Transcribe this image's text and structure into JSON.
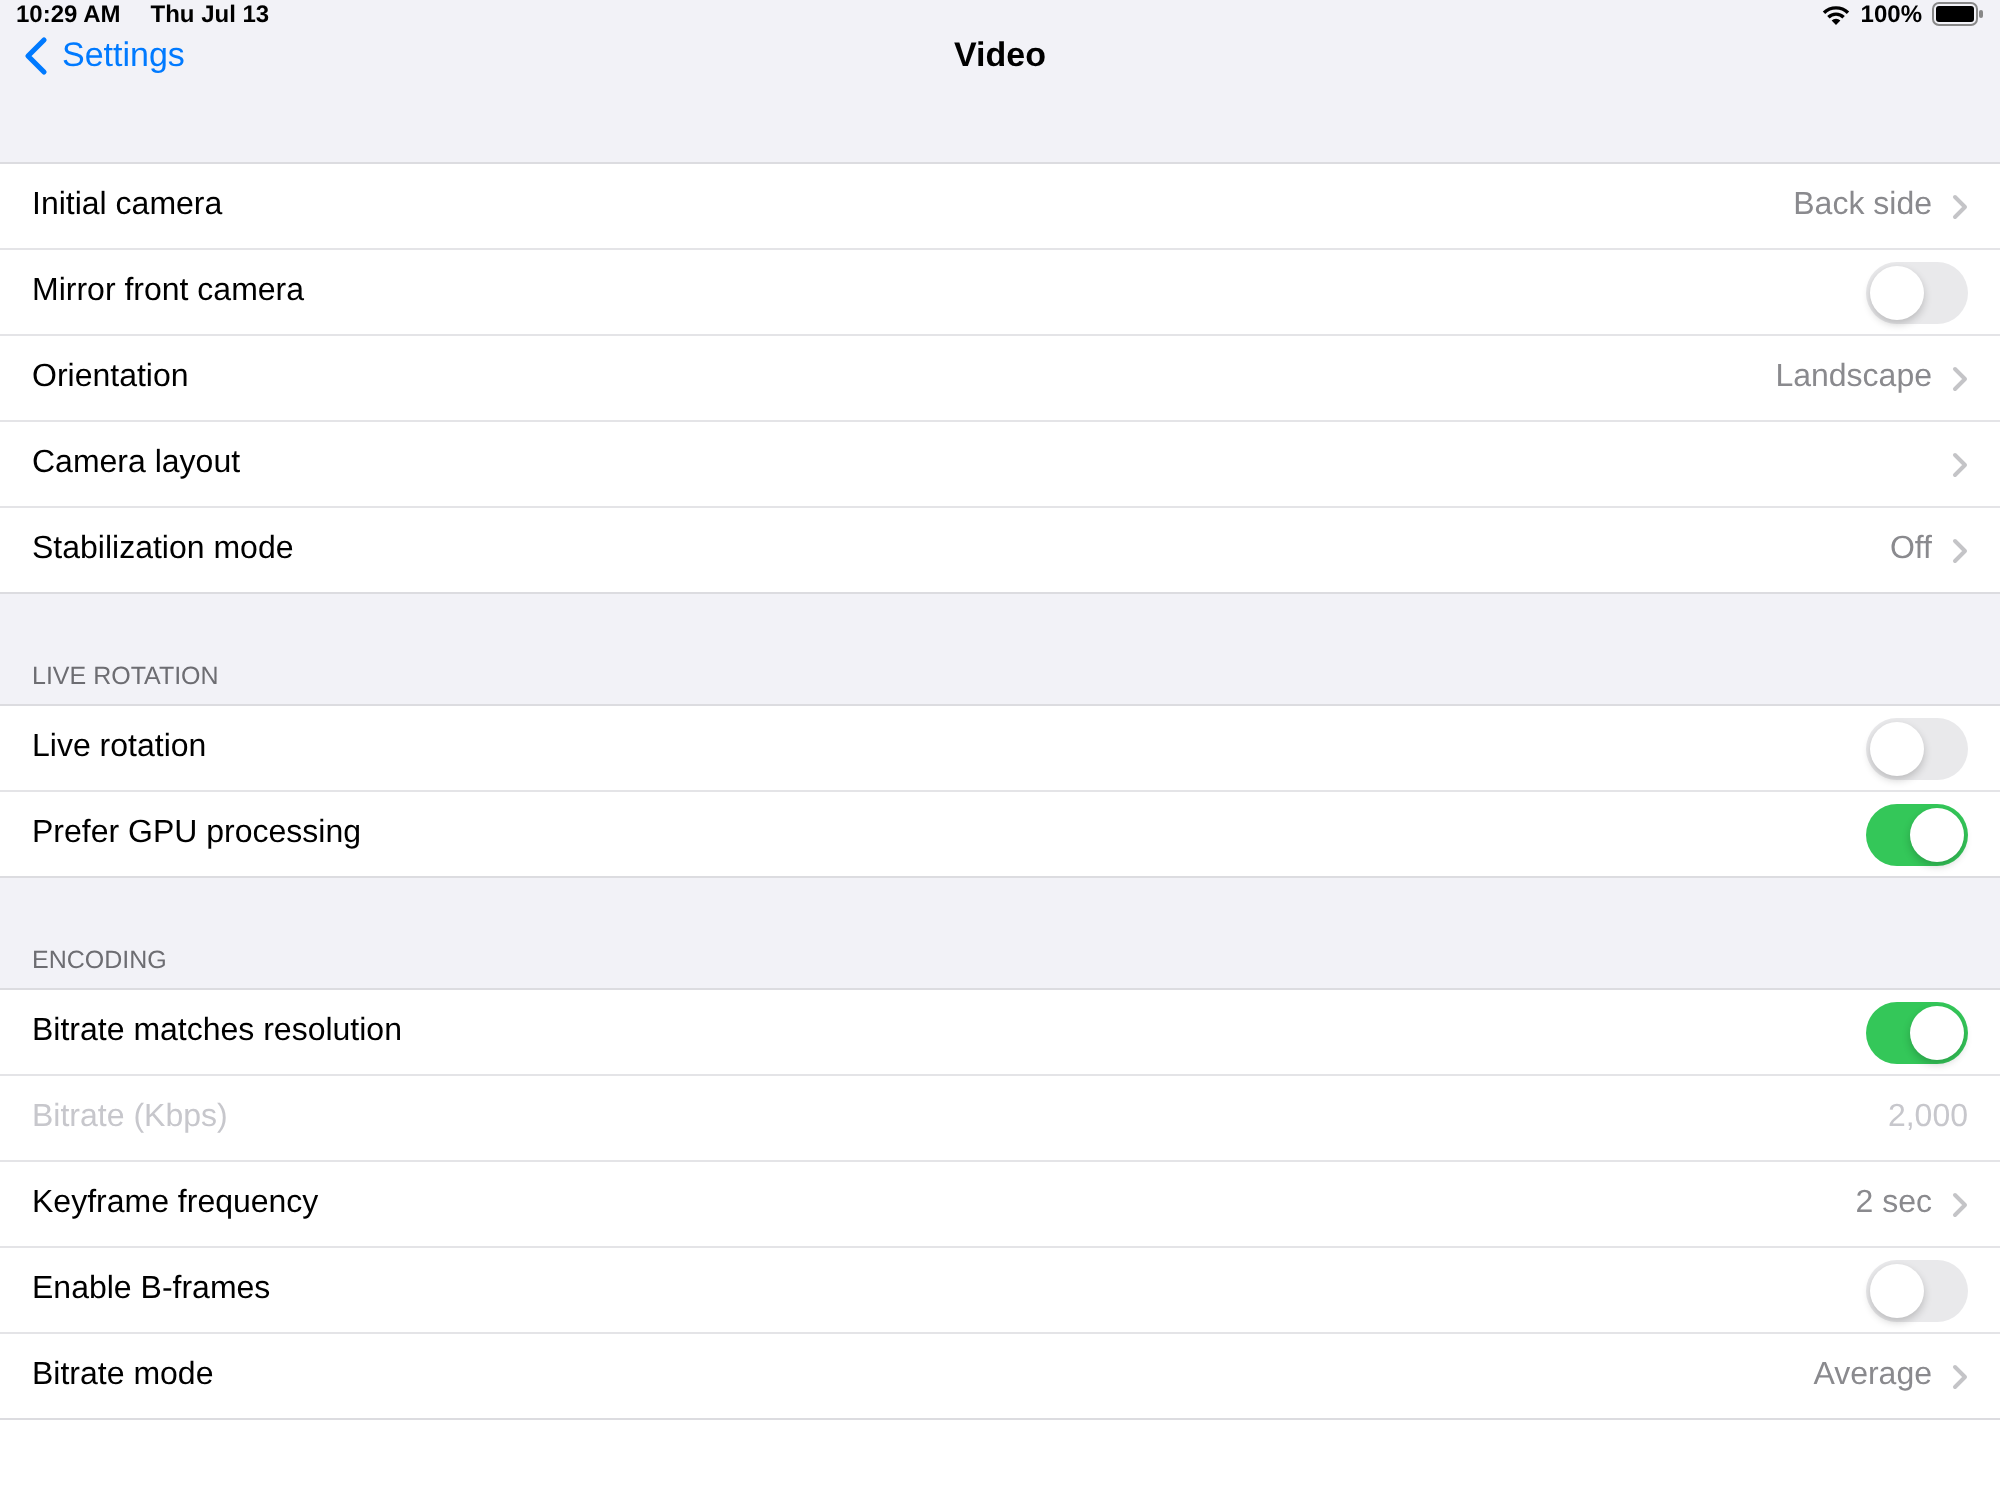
{
  "status_bar": {
    "time": "10:29 AM",
    "date": "Thu Jul 13",
    "battery": "100%"
  },
  "nav": {
    "back": "Settings",
    "title": "Video"
  },
  "sections": [
    {
      "rows": [
        {
          "kind": "nav",
          "label": "Initial camera",
          "value": "Back side"
        },
        {
          "kind": "toggle",
          "label": "Mirror front camera",
          "on": false
        },
        {
          "kind": "nav",
          "label": "Orientation",
          "value": "Landscape"
        },
        {
          "kind": "nav",
          "label": "Camera layout"
        },
        {
          "kind": "nav",
          "label": "Stabilization mode",
          "value": "Off"
        }
      ]
    },
    {
      "header": "LIVE ROTATION",
      "rows": [
        {
          "kind": "toggle",
          "label": "Live rotation",
          "on": false
        },
        {
          "kind": "toggle",
          "label": "Prefer GPU processing",
          "on": true
        }
      ]
    },
    {
      "header": "ENCODING",
      "rows": [
        {
          "kind": "toggle",
          "label": "Bitrate matches resolution",
          "on": true
        },
        {
          "kind": "value",
          "label": "Bitrate (Kbps)",
          "value": "2,000",
          "disabled": true
        },
        {
          "kind": "nav",
          "label": "Keyframe frequency",
          "value": "2 sec"
        },
        {
          "kind": "toggle",
          "label": "Enable B-frames",
          "on": false
        },
        {
          "kind": "nav",
          "label": "Bitrate mode",
          "value": "Average"
        }
      ]
    }
  ]
}
